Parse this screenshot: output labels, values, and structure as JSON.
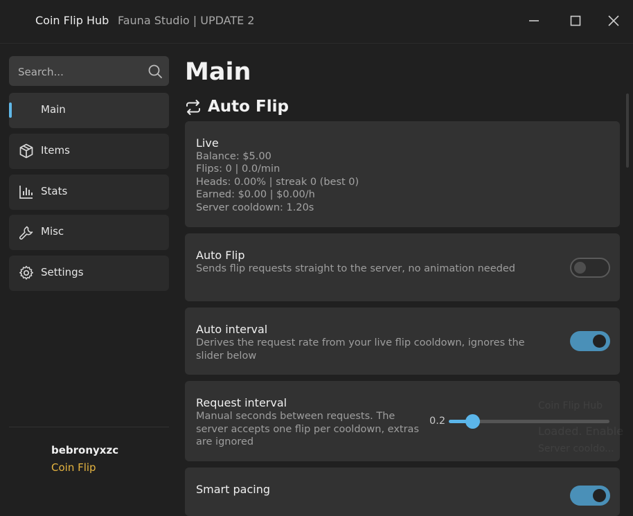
{
  "window": {
    "title": "Coin Flip Hub",
    "subtitle": "Fauna Studio | UPDATE 2"
  },
  "sidebar": {
    "search_placeholder": "Search...",
    "items": [
      {
        "label": "Main",
        "icon": "none",
        "active": true
      },
      {
        "label": "Items",
        "icon": "package-icon"
      },
      {
        "label": "Stats",
        "icon": "bar-chart-icon"
      },
      {
        "label": "Misc",
        "icon": "wrench-icon"
      },
      {
        "label": "Settings",
        "icon": "gear-icon"
      }
    ],
    "user": {
      "name": "bebronyxzc",
      "game": "Coin Flip"
    }
  },
  "main": {
    "title": "Main",
    "section_title": "Auto Flip",
    "section_icon": "swap-arrows-icon",
    "live": {
      "title": "Live",
      "lines": [
        "Balance: $5.00",
        "Flips: 0  |  0.0/min",
        "Heads: 0.00%  |  streak 0 (best 0)",
        "Earned: $0.00  |  $0.00/h",
        "Server cooldown: 1.20s"
      ]
    },
    "auto_flip": {
      "title": "Auto Flip",
      "description": "Sends flip requests straight to the server, no animation needed",
      "enabled": false
    },
    "auto_interval": {
      "title": "Auto interval",
      "description": "Derives the request rate from your live flip cooldown, ignores the slider below",
      "enabled": true
    },
    "request_interval": {
      "title": "Request interval",
      "description": "Manual seconds between requests. The server accepts one flip per cooldown, extras are ignored",
      "value": "0.2",
      "fraction": 0.15
    },
    "smart_pacing": {
      "title": "Smart pacing",
      "enabled": true
    }
  },
  "notification": {
    "title": "Coin Flip Hub",
    "line1": "Loaded. Enable",
    "line2": "Server cooldo..."
  },
  "colors": {
    "accent": "#5bb6ea",
    "toggle_on": "#4a90b8",
    "user_game": "#e5b440"
  }
}
